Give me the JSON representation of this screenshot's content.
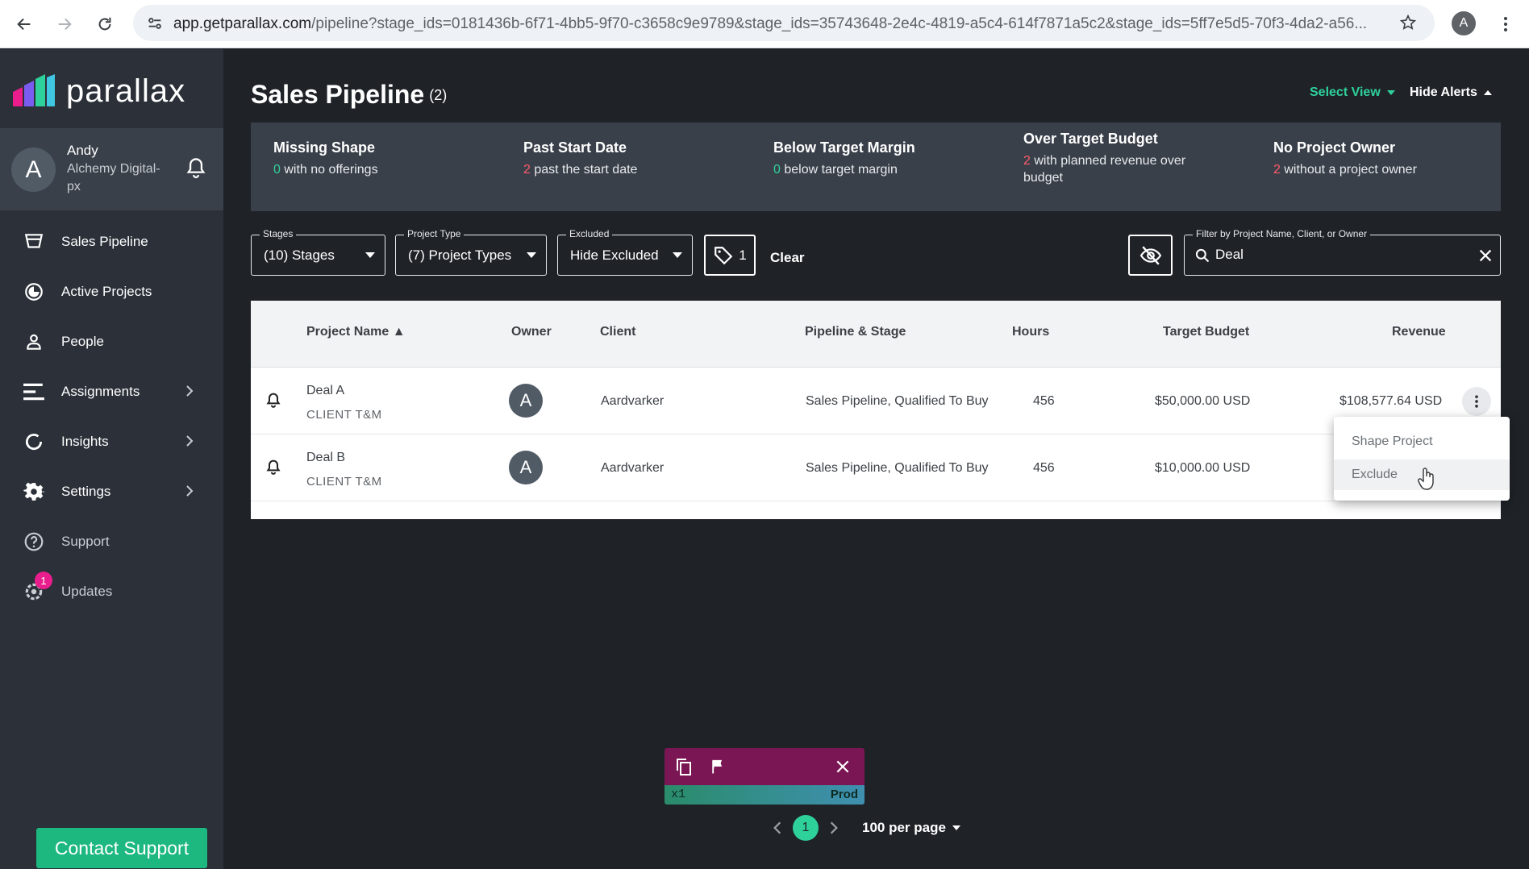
{
  "browser": {
    "url_host": "app.getparallax.com",
    "url_path": "/pipeline?stage_ids=0181436b-6f71-4bb5-9f70-c3658c9e9789&stage_ids=35743648-2e4c-4819-a5c4-614f7871a5c2&stage_ids=5ff7e5d5-70f3-4da2-a56...",
    "profile_initial": "A"
  },
  "sidebar": {
    "logo_text": "parallax",
    "user": {
      "initial": "A",
      "name": "Andy",
      "org": "Alchemy Digital-px"
    },
    "items": [
      {
        "label": "Sales Pipeline",
        "icon": "funnel-icon"
      },
      {
        "label": "Active Projects",
        "icon": "pie-icon"
      },
      {
        "label": "People",
        "icon": "person-icon"
      },
      {
        "label": "Assignments",
        "icon": "bars-icon"
      },
      {
        "label": "Insights",
        "icon": "refresh-icon"
      },
      {
        "label": "Settings",
        "icon": "gear-icon"
      },
      {
        "label": "Support",
        "icon": "help-icon"
      },
      {
        "label": "Updates",
        "icon": "gear-badge-icon",
        "badge": "1"
      }
    ],
    "contact_support": "Contact Support"
  },
  "header": {
    "title": "Sales Pipeline",
    "count": "(2)",
    "select_view": "Select View",
    "hide_alerts": "Hide Alerts"
  },
  "alerts": [
    {
      "title": "Missing Shape",
      "num": "0",
      "text": "with no offerings"
    },
    {
      "title": "Past Start Date",
      "num": "2",
      "text": "past the start date"
    },
    {
      "title": "Below Target Margin",
      "num": "0",
      "text": "below target margin"
    },
    {
      "title": "Over Target Budget",
      "num": "2",
      "text": "with planned revenue over budget"
    },
    {
      "title": "No Project Owner",
      "num": "2",
      "text": "without a project owner"
    }
  ],
  "filters": {
    "stages": {
      "label": "Stages",
      "value": "(10) Stages"
    },
    "project_type": {
      "label": "Project Type",
      "value": "(7) Project Types"
    },
    "excluded": {
      "label": "Excluded",
      "value": "Hide Excluded"
    },
    "tag_count": "1",
    "clear": "Clear",
    "search": {
      "label": "Filter by Project Name, Client, or Owner",
      "value": "Deal"
    }
  },
  "table": {
    "headers": {
      "project_name": "Project Name",
      "owner": "Owner",
      "client": "Client",
      "pipeline_stage": "Pipeline & Stage",
      "hours": "Hours",
      "target_budget": "Target Budget",
      "revenue": "Revenue"
    },
    "rows": [
      {
        "name": "Deal A",
        "type": "CLIENT T&M",
        "owner_initial": "A",
        "client": "Aardvarker",
        "stage": "Sales Pipeline, Qualified To Buy",
        "hours": "456",
        "budget": "$50,000.00 USD",
        "revenue": "$108,577.64 USD"
      },
      {
        "name": "Deal B",
        "type": "CLIENT T&M",
        "owner_initial": "A",
        "client": "Aardvarker",
        "stage": "Sales Pipeline, Qualified To Buy",
        "hours": "456",
        "budget": "$10,000.00 USD",
        "revenue": ""
      }
    ]
  },
  "context_menu": {
    "items": [
      "Shape Project",
      "Exclude"
    ]
  },
  "dev_toolbar": {
    "left": "x1",
    "right": "Prod"
  },
  "pagination": {
    "current": "1",
    "per_page": "100 per page"
  },
  "colors": {
    "accent_green": "#2ed19a",
    "alert_red": "#ff5a6a",
    "sidebar_bg": "#2b3039",
    "main_bg": "#1f2328"
  }
}
